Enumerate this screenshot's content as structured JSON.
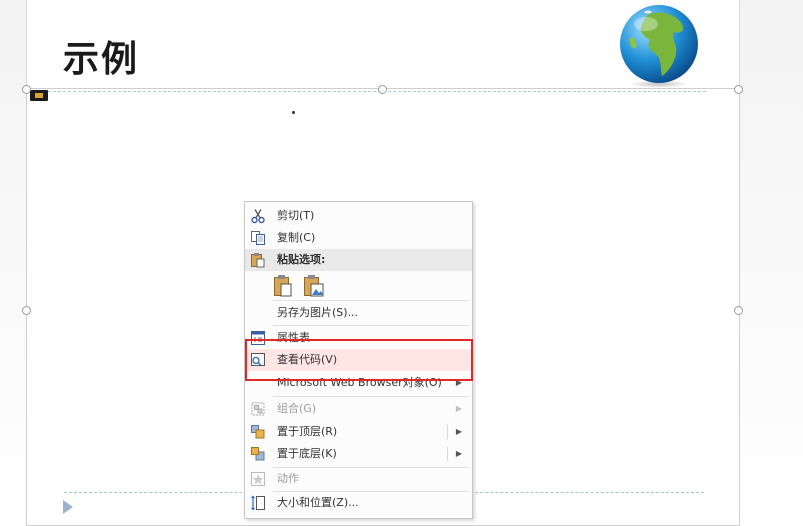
{
  "slide": {
    "title": "示例"
  },
  "context_menu": {
    "items": [
      {
        "label": "剪切(T)",
        "icon": "scissors-icon",
        "enabled": true
      },
      {
        "label": "复制(C)",
        "icon": "copy-icon",
        "enabled": true
      },
      {
        "label": "粘贴选项:",
        "icon": "paste-icon",
        "enabled": true
      },
      {
        "label": "另存为图片(S)...",
        "enabled": true
      },
      {
        "label": "属性表",
        "icon": "property-sheet-icon",
        "enabled": true
      },
      {
        "label": "查看代码(V)",
        "icon": "view-code-icon",
        "enabled": true,
        "highlighted": true
      },
      {
        "label": "Microsoft Web Browser对象(O)",
        "enabled": true,
        "submenu": true
      },
      {
        "label": "组合(G)",
        "icon": "group-icon",
        "enabled": false,
        "submenu": true
      },
      {
        "label": "置于顶层(R)",
        "icon": "bring-to-front-icon",
        "enabled": true,
        "submenu": true
      },
      {
        "label": "置于底层(K)",
        "icon": "send-to-back-icon",
        "enabled": true,
        "submenu": true
      },
      {
        "label": "动作",
        "icon": "action-icon",
        "enabled": false
      },
      {
        "label": "大小和位置(Z)...",
        "icon": "size-position-icon",
        "enabled": true
      }
    ],
    "arrow_glyph": "▶"
  },
  "colors": {
    "highlight_bg": "#fde6e4",
    "annotation_box": "#e02a2a"
  }
}
